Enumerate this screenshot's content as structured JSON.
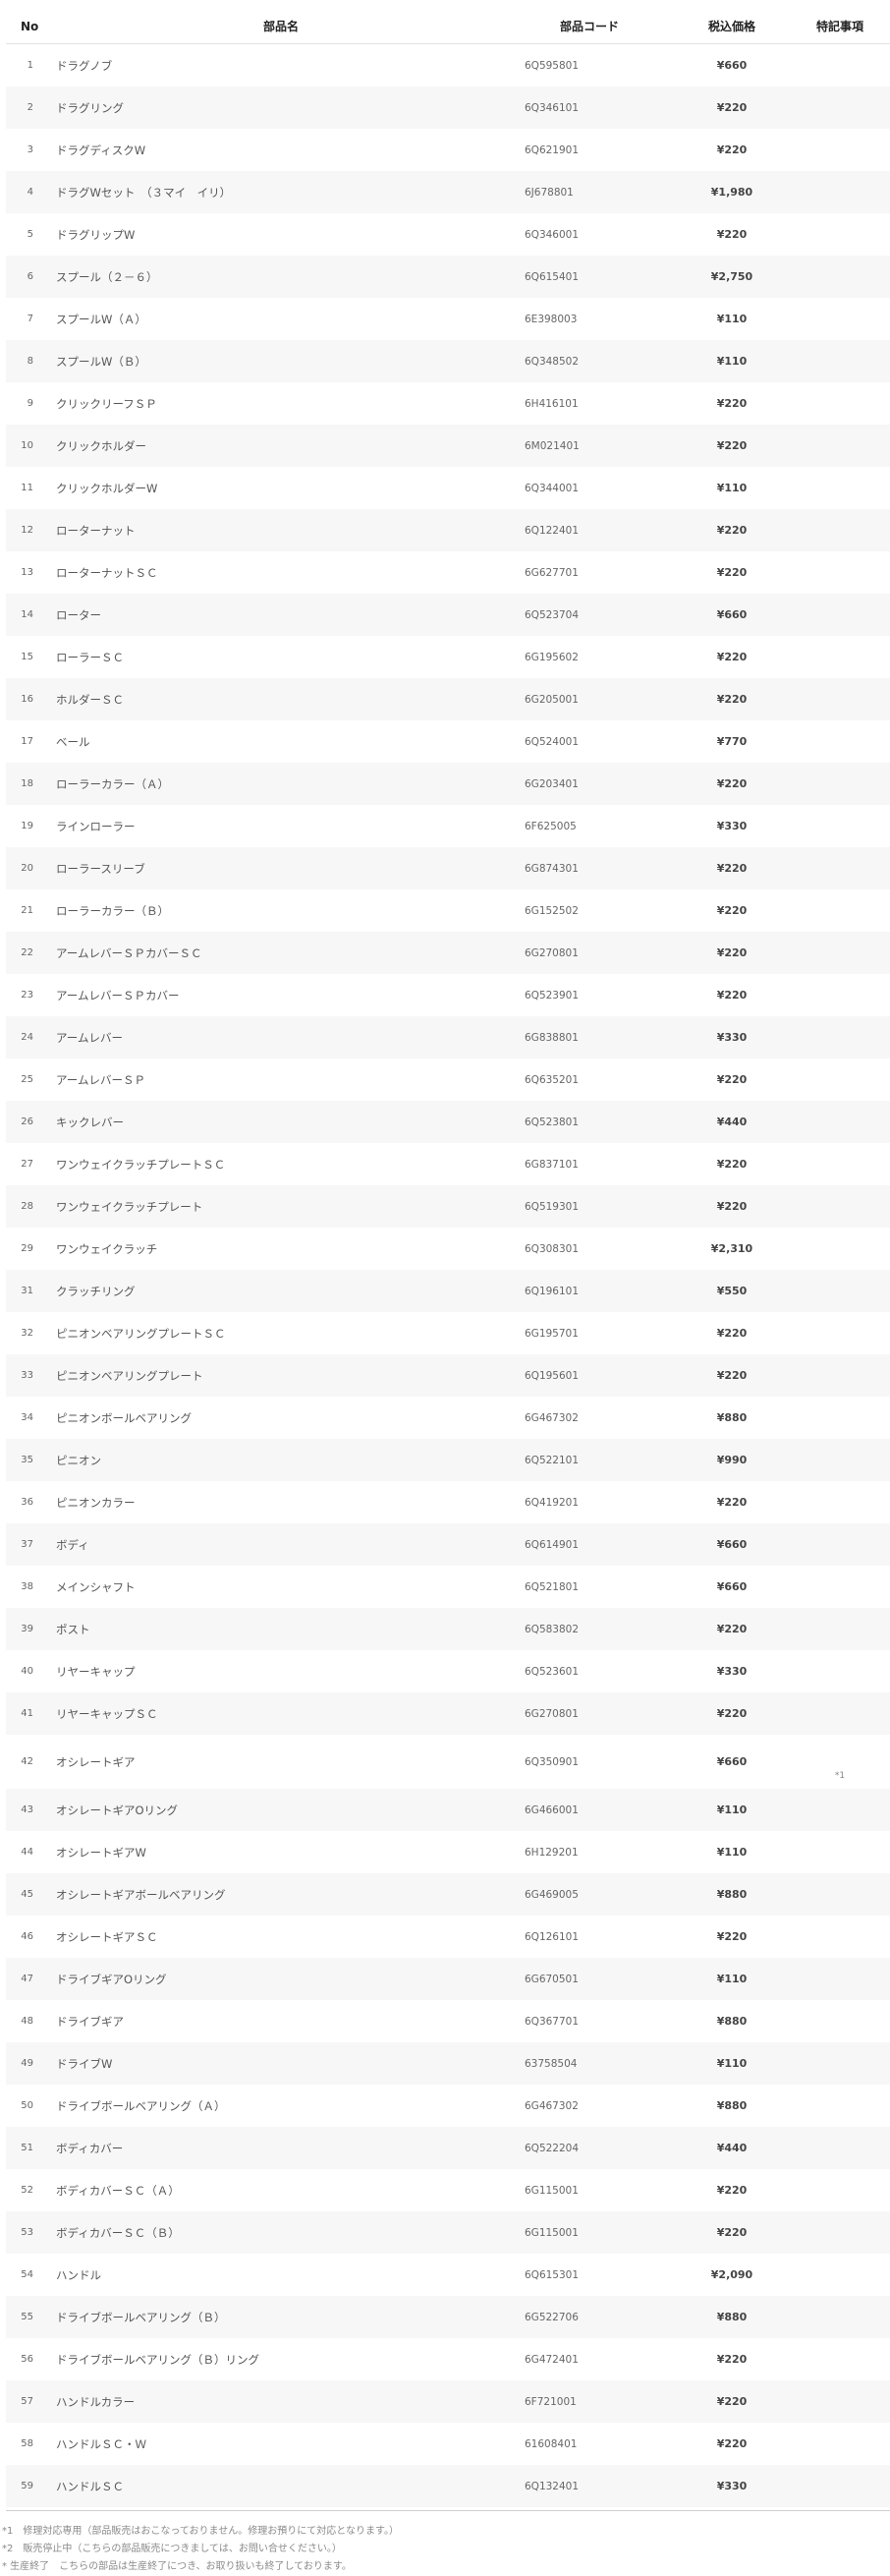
{
  "headers": {
    "no": "No",
    "name": "部品名",
    "code": "部品コード",
    "price": "税込価格",
    "note": "特記事項"
  },
  "rows": [
    {
      "no": "1",
      "name": "ドラグノブ",
      "code": "6Q595801",
      "price": "¥660",
      "note": ""
    },
    {
      "no": "2",
      "name": "ドラグリング",
      "code": "6Q346101",
      "price": "¥220",
      "note": ""
    },
    {
      "no": "3",
      "name": "ドラグディスクW",
      "code": "6Q621901",
      "price": "¥220",
      "note": ""
    },
    {
      "no": "4",
      "name": "ドラグWセット　（３マイ　イリ）",
      "code": "6J678801",
      "price": "¥1,980",
      "note": ""
    },
    {
      "no": "5",
      "name": "ドラグリップW",
      "code": "6Q346001",
      "price": "¥220",
      "note": ""
    },
    {
      "no": "6",
      "name": "スプール（２－６）",
      "code": "6Q615401",
      "price": "¥2,750",
      "note": ""
    },
    {
      "no": "7",
      "name": "スプールW（Ａ）",
      "code": "6E398003",
      "price": "¥110",
      "note": ""
    },
    {
      "no": "8",
      "name": "スプールW（Ｂ）",
      "code": "6Q348502",
      "price": "¥110",
      "note": ""
    },
    {
      "no": "9",
      "name": "クリックリーフＳＰ",
      "code": "6H416101",
      "price": "¥220",
      "note": ""
    },
    {
      "no": "10",
      "name": "クリックホルダー",
      "code": "6M021401",
      "price": "¥220",
      "note": ""
    },
    {
      "no": "11",
      "name": "クリックホルダーW",
      "code": "6Q344001",
      "price": "¥110",
      "note": ""
    },
    {
      "no": "12",
      "name": "ローターナット",
      "code": "6Q122401",
      "price": "¥220",
      "note": ""
    },
    {
      "no": "13",
      "name": "ローターナットＳＣ",
      "code": "6G627701",
      "price": "¥220",
      "note": ""
    },
    {
      "no": "14",
      "name": "ローター",
      "code": "6Q523704",
      "price": "¥660",
      "note": ""
    },
    {
      "no": "15",
      "name": "ローラーＳＣ",
      "code": "6G195602",
      "price": "¥220",
      "note": ""
    },
    {
      "no": "16",
      "name": "ホルダーＳＣ",
      "code": "6G205001",
      "price": "¥220",
      "note": ""
    },
    {
      "no": "17",
      "name": "ベール",
      "code": "6Q524001",
      "price": "¥770",
      "note": ""
    },
    {
      "no": "18",
      "name": "ローラーカラー（Ａ）",
      "code": "6G203401",
      "price": "¥220",
      "note": ""
    },
    {
      "no": "19",
      "name": "ラインローラー",
      "code": "6F625005",
      "price": "¥330",
      "note": ""
    },
    {
      "no": "20",
      "name": "ローラースリーブ",
      "code": "6G874301",
      "price": "¥220",
      "note": ""
    },
    {
      "no": "21",
      "name": "ローラーカラー（Ｂ）",
      "code": "6G152502",
      "price": "¥220",
      "note": ""
    },
    {
      "no": "22",
      "name": "アームレバーＳＰカバーＳＣ",
      "code": "6G270801",
      "price": "¥220",
      "note": ""
    },
    {
      "no": "23",
      "name": "アームレバーＳＰカバー",
      "code": "6Q523901",
      "price": "¥220",
      "note": ""
    },
    {
      "no": "24",
      "name": "アームレバー",
      "code": "6G838801",
      "price": "¥330",
      "note": ""
    },
    {
      "no": "25",
      "name": "アームレバーＳＰ",
      "code": "6Q635201",
      "price": "¥220",
      "note": ""
    },
    {
      "no": "26",
      "name": "キックレバー",
      "code": "6Q523801",
      "price": "¥440",
      "note": ""
    },
    {
      "no": "27",
      "name": "ワンウェイクラッチプレートＳＣ",
      "code": "6G837101",
      "price": "¥220",
      "note": ""
    },
    {
      "no": "28",
      "name": "ワンウェイクラッチプレート",
      "code": "6Q519301",
      "price": "¥220",
      "note": ""
    },
    {
      "no": "29",
      "name": "ワンウェイクラッチ",
      "code": "6Q308301",
      "price": "¥2,310",
      "note": ""
    },
    {
      "no": "31",
      "name": "クラッチリング",
      "code": "6Q196101",
      "price": "¥550",
      "note": ""
    },
    {
      "no": "32",
      "name": "ピニオンベアリングプレートＳＣ",
      "code": "6G195701",
      "price": "¥220",
      "note": ""
    },
    {
      "no": "33",
      "name": "ピニオンベアリングプレート",
      "code": "6Q195601",
      "price": "¥220",
      "note": ""
    },
    {
      "no": "34",
      "name": "ピニオンボールベアリング",
      "code": "6G467302",
      "price": "¥880",
      "note": ""
    },
    {
      "no": "35",
      "name": "ピニオン",
      "code": "6Q522101",
      "price": "¥990",
      "note": ""
    },
    {
      "no": "36",
      "name": "ピニオンカラー",
      "code": "6Q419201",
      "price": "¥220",
      "note": ""
    },
    {
      "no": "37",
      "name": "ボディ",
      "code": "6Q614901",
      "price": "¥660",
      "note": ""
    },
    {
      "no": "38",
      "name": "メインシャフト",
      "code": "6Q521801",
      "price": "¥660",
      "note": ""
    },
    {
      "no": "39",
      "name": "ポスト",
      "code": "6Q583802",
      "price": "¥220",
      "note": ""
    },
    {
      "no": "40",
      "name": "リヤーキャップ",
      "code": "6Q523601",
      "price": "¥330",
      "note": ""
    },
    {
      "no": "41",
      "name": "リヤーキャップＳＣ",
      "code": "6G270801",
      "price": "¥220",
      "note": ""
    },
    {
      "no": "42",
      "name": "オシレートギア",
      "code": "6Q350901",
      "price": "¥660",
      "note": "*1"
    },
    {
      "no": "43",
      "name": "オシレートギアOリング",
      "code": "6G466001",
      "price": "¥110",
      "note": ""
    },
    {
      "no": "44",
      "name": "オシレートギアW",
      "code": "6H129201",
      "price": "¥110",
      "note": ""
    },
    {
      "no": "45",
      "name": "オシレートギアボールベアリング",
      "code": "6G469005",
      "price": "¥880",
      "note": ""
    },
    {
      "no": "46",
      "name": "オシレートギアＳＣ",
      "code": "6Q126101",
      "price": "¥220",
      "note": ""
    },
    {
      "no": "47",
      "name": "ドライブギアOリング",
      "code": "6G670501",
      "price": "¥110",
      "note": ""
    },
    {
      "no": "48",
      "name": "ドライブギア",
      "code": "6Q367701",
      "price": "¥880",
      "note": ""
    },
    {
      "no": "49",
      "name": "ドライブW",
      "code": "63758504",
      "price": "¥110",
      "note": ""
    },
    {
      "no": "50",
      "name": "ドライブボールベアリング（Ａ）",
      "code": "6G467302",
      "price": "¥880",
      "note": ""
    },
    {
      "no": "51",
      "name": "ボディカバー",
      "code": "6Q522204",
      "price": "¥440",
      "note": ""
    },
    {
      "no": "52",
      "name": "ボディカバーＳＣ（Ａ）",
      "code": "6G115001",
      "price": "¥220",
      "note": ""
    },
    {
      "no": "53",
      "name": "ボディカバーＳＣ（Ｂ）",
      "code": "6G115001",
      "price": "¥220",
      "note": ""
    },
    {
      "no": "54",
      "name": "ハンドル",
      "code": "6Q615301",
      "price": "¥2,090",
      "note": ""
    },
    {
      "no": "55",
      "name": "ドライブボールベアリング（Ｂ）",
      "code": "6G522706",
      "price": "¥880",
      "note": ""
    },
    {
      "no": "56",
      "name": "ドライブボールベアリング（Ｂ）リング",
      "code": "6G472401",
      "price": "¥220",
      "note": ""
    },
    {
      "no": "57",
      "name": "ハンドルカラー",
      "code": "6F721001",
      "price": "¥220",
      "note": ""
    },
    {
      "no": "58",
      "name": "ハンドルＳＣ・Ｗ",
      "code": "61608401",
      "price": "¥220",
      "note": ""
    },
    {
      "no": "59",
      "name": "ハンドルＳＣ",
      "code": "6Q132401",
      "price": "¥330",
      "note": ""
    }
  ],
  "footnotes": [
    "*1　修理対応専用（部品販売はおこなっておりません。修理お預りにて対応となります。）",
    "*2　販売停止中（こちらの部品販売につきましては、お問い合せください。）",
    "* 生産終了　こちらの部品は生産終了につき、お取り扱いも終了しております。"
  ]
}
